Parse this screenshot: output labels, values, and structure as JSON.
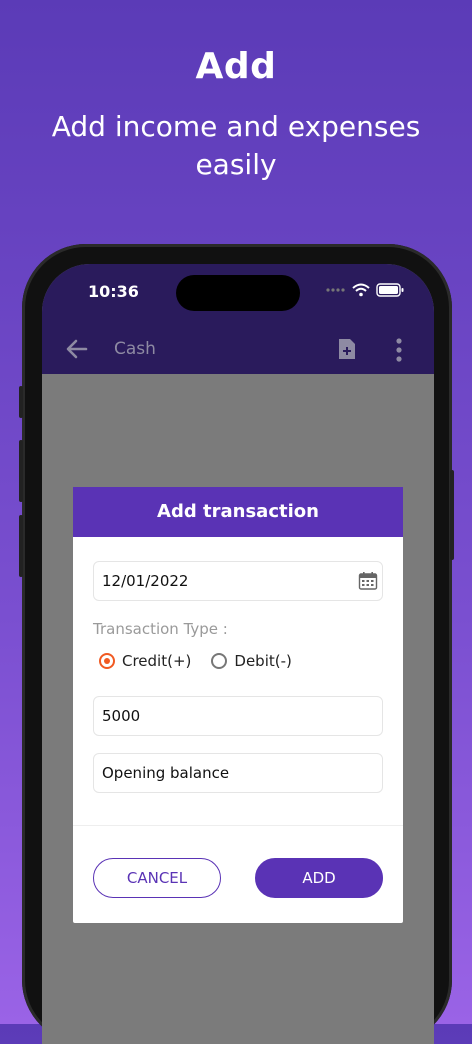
{
  "promo": {
    "title": "Add",
    "subtitle": "Add income and expenses easily"
  },
  "status_bar": {
    "time": "10:36"
  },
  "app_bar": {
    "title": "Cash"
  },
  "dialog": {
    "title": "Add transaction",
    "date_value": "12/01/2022",
    "transaction_type_label": "Transaction Type :",
    "radio_options": [
      {
        "label": "Credit(+)",
        "selected": true
      },
      {
        "label": "Debit(-)",
        "selected": false
      }
    ],
    "amount_value": "5000",
    "note_value": "Opening balance",
    "cancel_label": "CANCEL",
    "add_label": "ADD"
  },
  "colors": {
    "accent": "#5a33b5",
    "radio_selected": "#f15a22",
    "appbar": "#2a1b5c"
  }
}
